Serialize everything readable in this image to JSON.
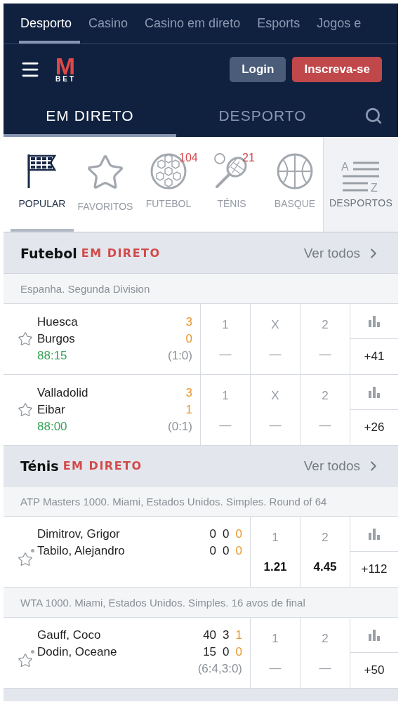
{
  "top_tabs": [
    {
      "label": "Desporto",
      "selected": true
    },
    {
      "label": "Casino",
      "selected": false
    },
    {
      "label": "Casino em direto",
      "selected": false
    },
    {
      "label": "Esports",
      "selected": false
    },
    {
      "label": "Jogos e",
      "selected": false
    }
  ],
  "logo": {
    "mark": "M",
    "text": "BET"
  },
  "buttons": [
    {
      "label": "Login",
      "kind": "secondary"
    },
    {
      "label": "Inscreva-se",
      "kind": "primary"
    }
  ],
  "mode_tabs": [
    {
      "label": "EM DIRETO",
      "selected": true
    },
    {
      "label": "DESPORTO",
      "selected": false
    }
  ],
  "sports": [
    {
      "label": "POPULAR",
      "kind": "flag",
      "selected": true
    },
    {
      "label": "FAVORITOS",
      "kind": "star",
      "selected": false
    },
    {
      "label": "FUTEBOL",
      "kind": "soccer",
      "selected": false,
      "count": "104"
    },
    {
      "label": "TÉNIS",
      "kind": "tennis",
      "selected": false,
      "count": "21"
    },
    {
      "label": "BASQUE",
      "kind": "basketball",
      "selected": false
    }
  ],
  "sports_menu": {
    "label": "DESPORTOS",
    "top_letter": "A",
    "bottom_letter": "Z"
  },
  "sections": [
    {
      "kind": "football",
      "title": "Futebol",
      "live_label": "EM DIRETO",
      "link": "Ver todos",
      "leagues": [
        {
          "name": "Espanha. Segunda Division",
          "matches": [
            {
              "teams": [
                {
                  "name": "Huesca",
                  "score": "3"
                },
                {
                  "name": "Burgos",
                  "score": "0"
                }
              ],
              "time": "88:15",
              "half_score": "(1:0)",
              "odds": [
                {
                  "label": "1",
                  "value": "—"
                },
                {
                  "label": "X",
                  "value": "—"
                },
                {
                  "label": "2",
                  "value": "—"
                }
              ],
              "more": "+41"
            },
            {
              "teams": [
                {
                  "name": "Valladolid",
                  "score": "3"
                },
                {
                  "name": "Eibar",
                  "score": "1"
                }
              ],
              "time": "88:00",
              "half_score": "(0:1)",
              "odds": [
                {
                  "label": "1",
                  "value": "—"
                },
                {
                  "label": "X",
                  "value": "—"
                },
                {
                  "label": "2",
                  "value": "—"
                }
              ],
              "more": "+26"
            }
          ]
        }
      ]
    },
    {
      "kind": "tennis",
      "title": "Ténis",
      "live_label": "EM DIRETO",
      "link": "Ver todos",
      "leagues": [
        {
          "name": "ATP Masters 1000. Miami, Estados Unidos. Simples. Round of 64",
          "matches": [
            {
              "teams": [
                {
                  "name": "Dimitrov, Grigor",
                  "serving": false,
                  "scores": [
                    "0",
                    "0",
                    "0"
                  ]
                },
                {
                  "name": "Tabilo, Alejandro",
                  "serving": true,
                  "scores": [
                    "0",
                    "0",
                    "0"
                  ]
                }
              ],
              "odds": [
                {
                  "label": "1",
                  "value": "1.21"
                },
                {
                  "label": "2",
                  "value": "4.45"
                }
              ],
              "more": "+112"
            }
          ]
        },
        {
          "name": "WTA 1000. Miami, Estados Unidos. Simples. 16 avos de final",
          "matches": [
            {
              "teams": [
                {
                  "name": "Gauff, Coco",
                  "serving": false,
                  "scores": [
                    "40",
                    "3",
                    "1"
                  ]
                },
                {
                  "name": "Dodin, Oceane",
                  "serving": true,
                  "scores": [
                    "15",
                    "0",
                    "0"
                  ]
                }
              ],
              "set_scores": "(6:4,3:0)",
              "odds": [
                {
                  "label": "1",
                  "value": "—"
                },
                {
                  "label": "2",
                  "value": "—"
                }
              ],
              "more": "+50"
            }
          ]
        }
      ]
    }
  ]
}
